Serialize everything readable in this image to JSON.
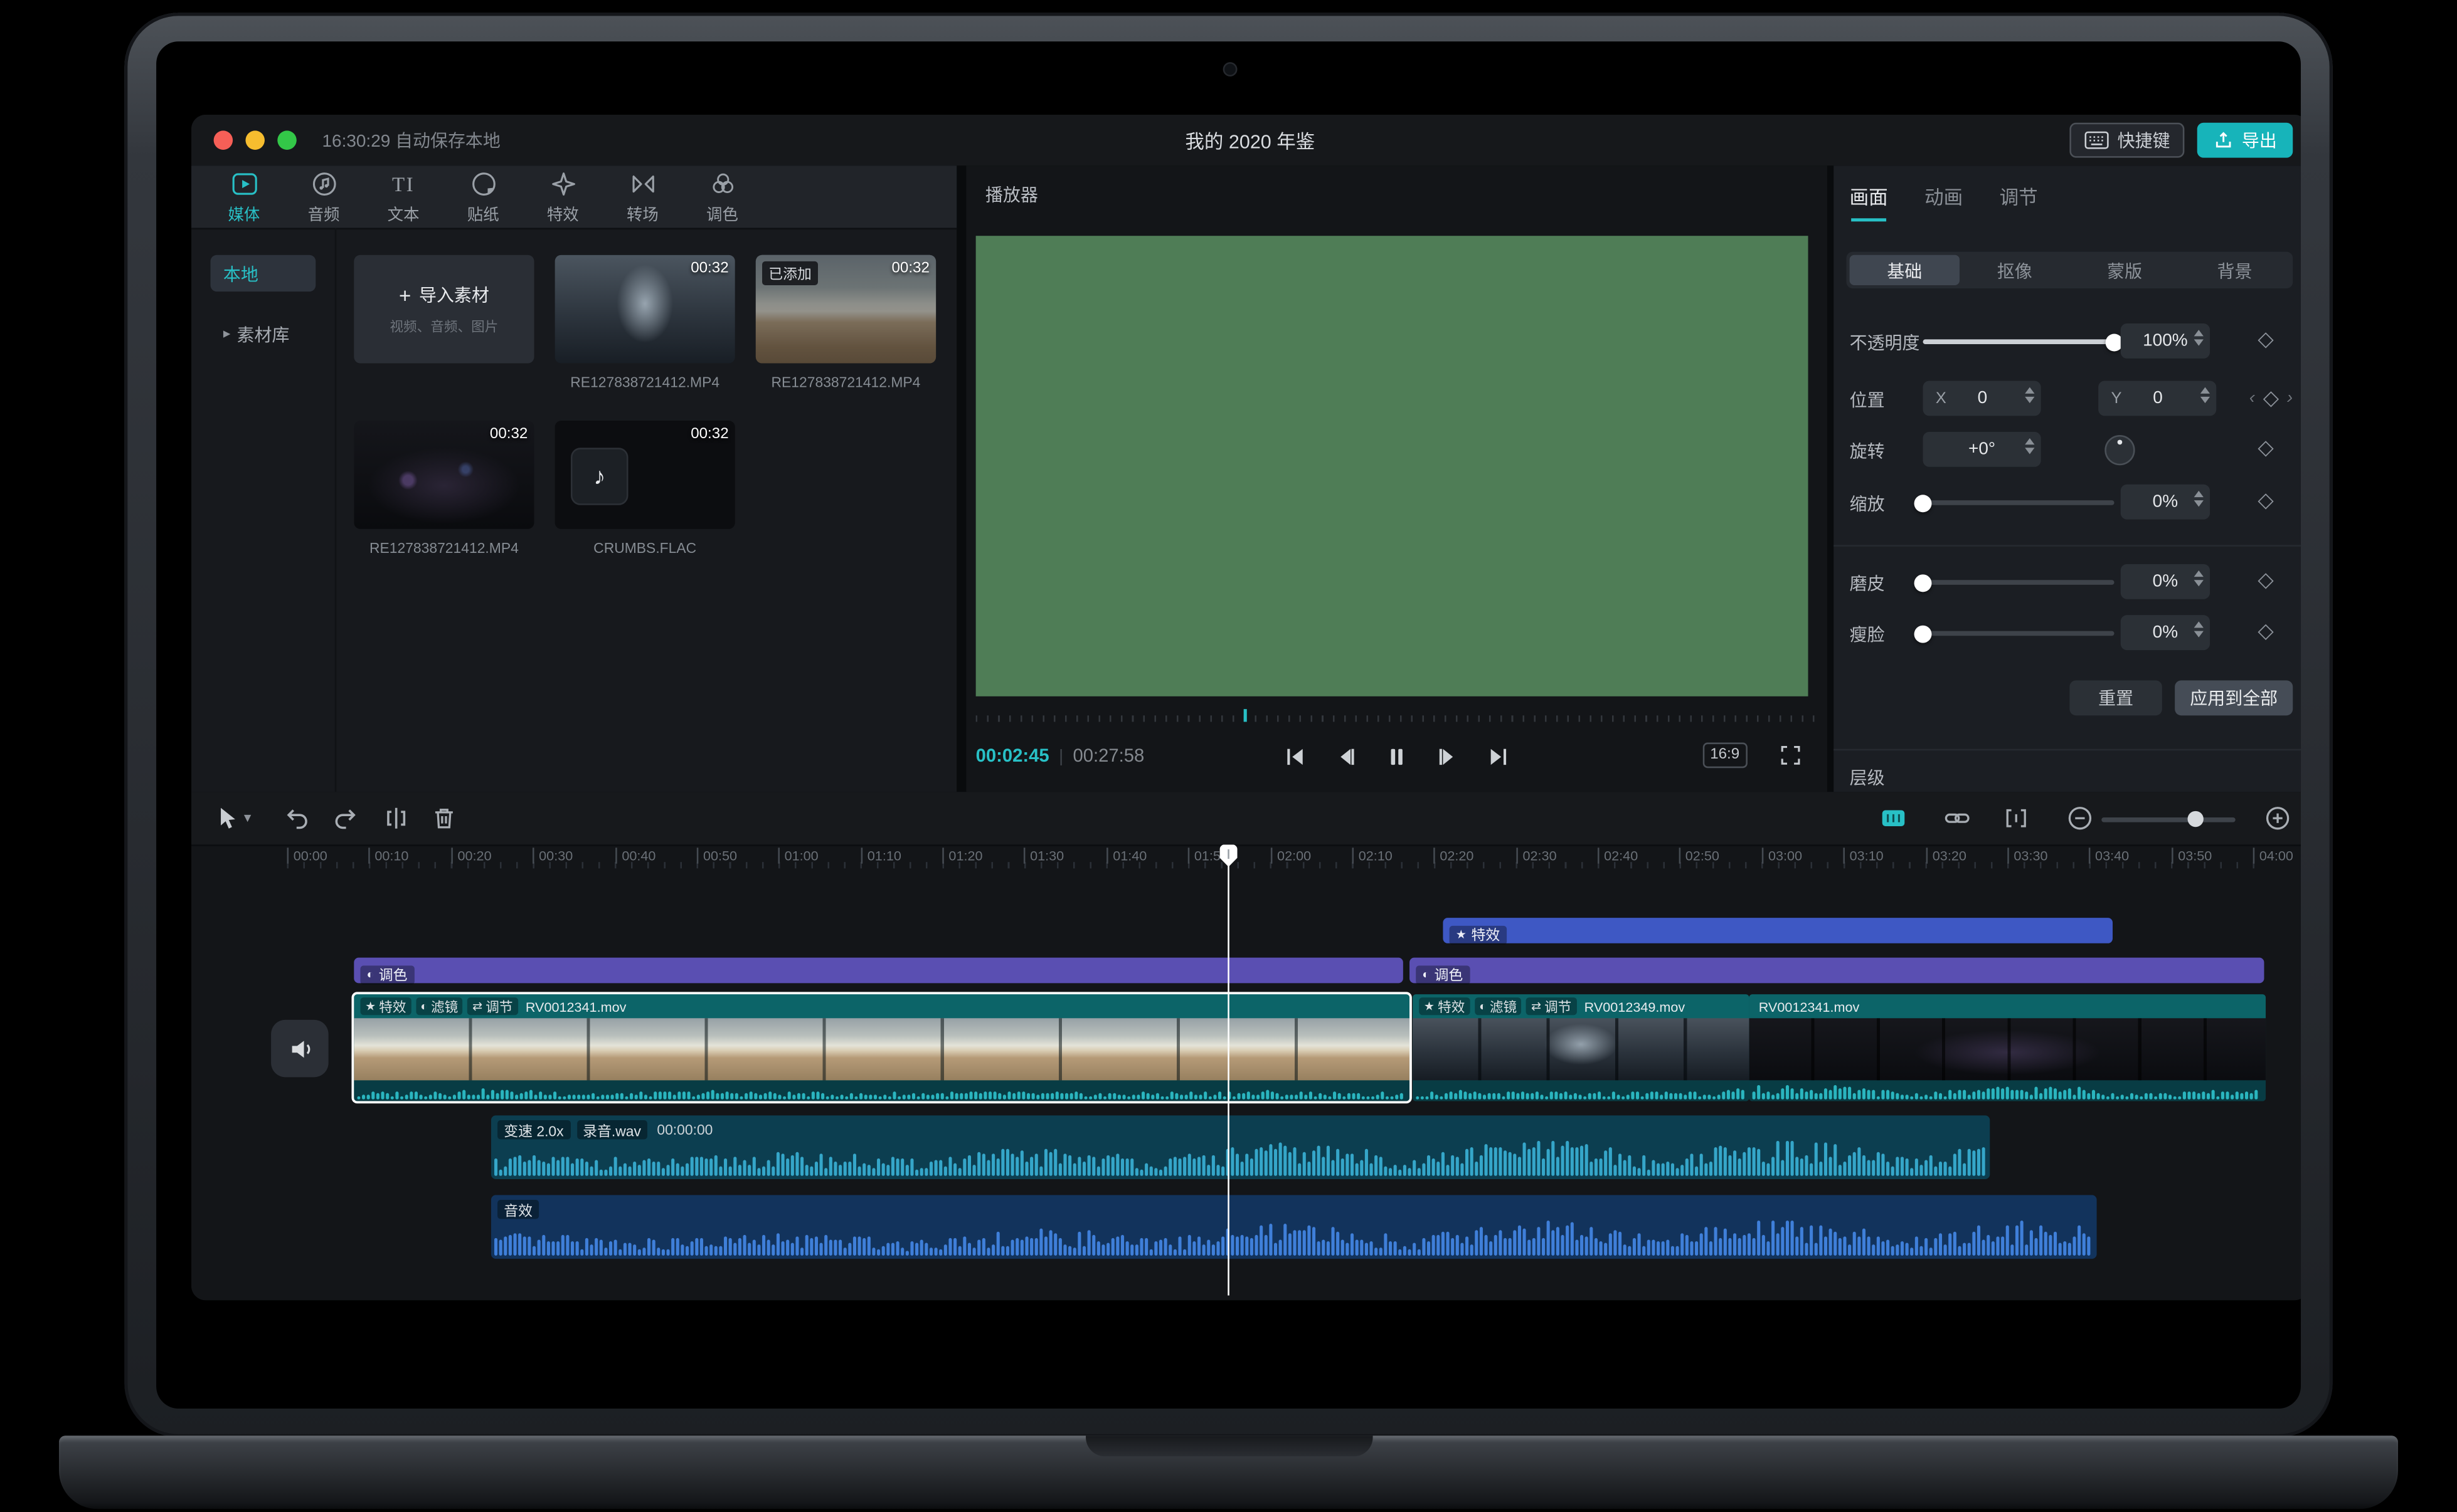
{
  "colors": {
    "accent": "#28c0c6",
    "export_button": "#17b4ba",
    "preview_green": "#4f7d56",
    "effect_track": "#3e58c4",
    "color_track": "#5a4fb2",
    "video_clip": "#0c6468",
    "audio_wave_speech": "#35a6c9",
    "audio_wave_sfx": "#3f7fd9"
  },
  "icons": {
    "keyframe_diamond": "◇",
    "chevron_left": "‹",
    "chevron_right": "›",
    "dropdown_arrow": "▾",
    "library_arrow": "▸",
    "plus": "+",
    "music_note": "♪",
    "text_icon": "TI",
    "effect_icon": "★",
    "filter_icon": "◐",
    "adjust_icon": "⇄",
    "color_icon": "◐"
  },
  "titlebar": {
    "autosave": "16:30:29 自动保存本地",
    "title": "我的 2020 年鉴",
    "shortcuts_button": "快捷键",
    "export_button": "导出"
  },
  "media_panel": {
    "tabs": [
      {
        "label": "媒体"
      },
      {
        "label": "音频"
      },
      {
        "label": "文本"
      },
      {
        "label": "贴纸"
      },
      {
        "label": "特效"
      },
      {
        "label": "转场"
      },
      {
        "label": "调色"
      }
    ],
    "active_tab": "媒体",
    "sidebar": [
      {
        "label": "本地"
      },
      {
        "label": "素材库"
      }
    ],
    "active_sidebar": "本地",
    "import_card": {
      "label": "导入素材",
      "hint": "视频、音频、图片"
    },
    "items": [
      {
        "type": "video",
        "name": "RE127838721412.MP4",
        "duration": "00:32"
      },
      {
        "type": "video",
        "name": "RE127838721412.MP4",
        "duration": "00:32",
        "badge": "已添加"
      },
      {
        "type": "video",
        "name": "RE127838721412.MP4",
        "duration": "00:32"
      },
      {
        "type": "audio",
        "name": "CRUMBS.FLAC",
        "duration": "00:32"
      }
    ]
  },
  "player": {
    "title": "播放器",
    "current_time": "00:02:45",
    "duration": "00:27:58",
    "aspect_ratio": "16:9"
  },
  "inspector": {
    "tabs": [
      "画面",
      "动画",
      "调节"
    ],
    "active_tab": "画面",
    "subtabs": [
      "基础",
      "抠像",
      "蒙版",
      "背景"
    ],
    "active_subtab": "基础",
    "rows": {
      "opacity": {
        "label": "不透明度",
        "value": "100%"
      },
      "position": {
        "label": "位置",
        "x_label": "X",
        "x_value": "0",
        "y_label": "Y",
        "y_value": "0"
      },
      "rotation": {
        "label": "旋转",
        "value": "+0°"
      },
      "scale": {
        "label": "缩放",
        "value": "0%"
      },
      "smooth_skin": {
        "label": "磨皮",
        "value": "0%"
      },
      "slim_face": {
        "label": "瘦脸",
        "value": "0%"
      }
    },
    "reset_button": "重置",
    "apply_all_button": "应用到全部",
    "layer_label": "层级"
  },
  "timeline": {
    "ruler": [
      "00:00",
      "00:10",
      "00:20",
      "00:30",
      "00:40",
      "00:50",
      "01:00",
      "01:10",
      "01:20",
      "01:30",
      "01:40",
      "01:50",
      "02:00",
      "02:10",
      "02:20",
      "02:30",
      "02:40",
      "02:50",
      "03:00",
      "03:10",
      "03:20",
      "03:30",
      "03:40",
      "03:50",
      "04:00"
    ],
    "effect_track": {
      "label": "特效"
    },
    "color_clips": [
      {
        "label": "调色"
      },
      {
        "label": "调色"
      }
    ],
    "video_clips": [
      {
        "badges": [
          "特效",
          "滤镜",
          "调节"
        ],
        "name": "RV0012341.mov"
      },
      {
        "badges": [
          "特效",
          "滤镜",
          "调节"
        ],
        "name": "RV0012349.mov"
      },
      {
        "badges": [],
        "name": "RV0012341.mov"
      }
    ],
    "audio_clips": [
      {
        "chips": [
          "变速 2.0x",
          "录音.wav"
        ],
        "time": "00:00:00"
      },
      {
        "chips": [
          "音效"
        ]
      }
    ]
  }
}
